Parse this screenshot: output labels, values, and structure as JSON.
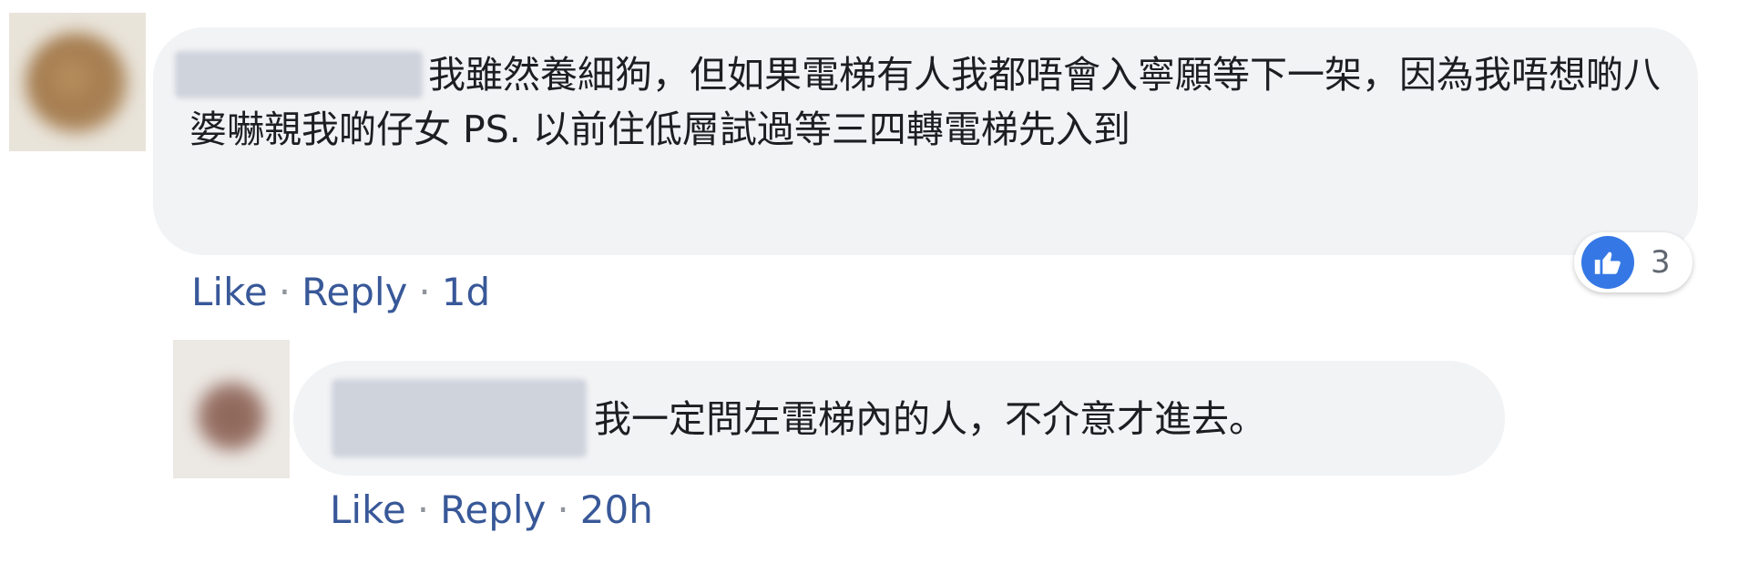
{
  "comments": {
    "main": {
      "text": "我雖然養細狗，但如果電梯有人我都唔會入寧願等下一架，因為我唔想啲八婆嚇親我啲仔女 PS. 以前住低層試過等三四轉電梯先入到",
      "actions": {
        "like": "Like",
        "reply": "Reply",
        "separator": "·",
        "time": "1d"
      },
      "reactions": {
        "icon": "thumbs-up-icon",
        "count": "3",
        "color": "#3578e5"
      }
    },
    "reply": {
      "text": "我一定問左電梯內的人，不介意才進去。",
      "actions": {
        "like": "Like",
        "reply": "Reply",
        "separator": "·",
        "time": "20h"
      }
    }
  },
  "colors": {
    "bubble": "#f2f3f5",
    "link": "#385898",
    "text": "#1c1e21"
  }
}
